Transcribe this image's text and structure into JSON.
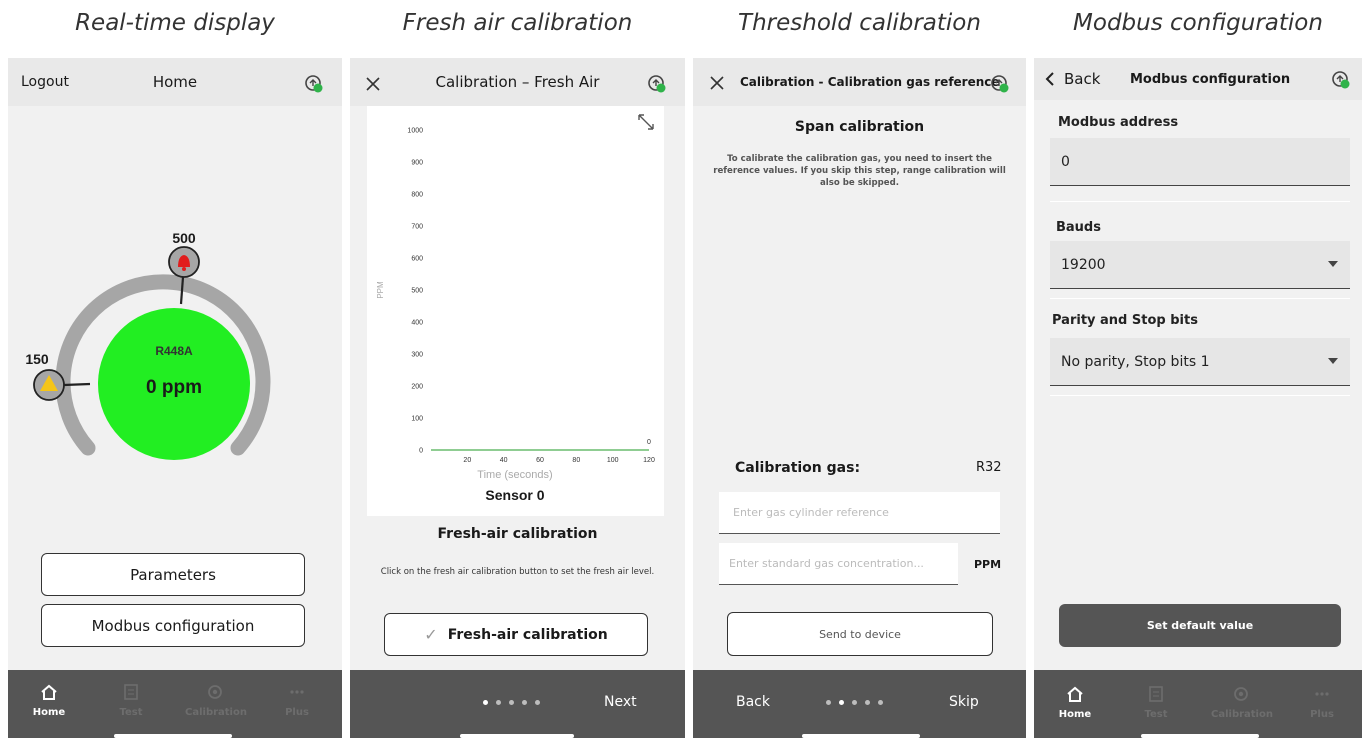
{
  "captions": [
    "Real-time display",
    "Fresh air calibration",
    "Threshold calibration",
    "Modbus configuration"
  ],
  "icons": {
    "status": "sync-status-icon",
    "close": "close-icon",
    "expand": "expand-icon",
    "alarm": "bell-alarm-icon",
    "warning": "warning-icon",
    "check": "check-icon",
    "back": "chevron-left-icon"
  },
  "colors": {
    "gauge_fill": "#22ee22",
    "gauge_ring": "#a6a6a6",
    "alarm_icon": "#e11d1d",
    "warning_icon": "#f5c518",
    "status_green": "#2fb34a",
    "bar_dark": "#555555"
  },
  "nav_labels": [
    "Home",
    "Test",
    "Calibration",
    "Plus"
  ],
  "nav_icons": [
    "home-icon",
    "test-icon",
    "calibration-icon",
    "more-icon"
  ],
  "screen1": {
    "logout": "Logout",
    "title": "Home",
    "gas_name": "R448A",
    "reading": "0 ppm",
    "alarm_threshold": "500",
    "warning_threshold": "150",
    "buttons": [
      "Parameters",
      "Modbus configuration"
    ]
  },
  "screen2": {
    "title": "Calibration – Fresh Air",
    "chart_heading": "Sensor 0",
    "section_title": "Fresh-air calibration",
    "instruction": "Click on the fresh air calibration button to set the fresh air level.",
    "button": "Fresh-air calibration",
    "next": "Next",
    "step": 1,
    "steps": 5
  },
  "chart_data": {
    "type": "line",
    "title": "Sensor 0",
    "xlabel": "Time (seconds)",
    "ylabel": "PPM",
    "xlim": [
      0,
      120
    ],
    "ylim": [
      0,
      1000
    ],
    "x_ticks": [
      20,
      40,
      60,
      80,
      100,
      120
    ],
    "y_ticks": [
      0,
      100,
      200,
      300,
      400,
      500,
      600,
      700,
      800,
      900,
      1000
    ],
    "series": [
      {
        "x": [
          0,
          20,
          40,
          60,
          80,
          100,
          120
        ],
        "y": [
          0,
          0,
          0,
          0,
          0,
          0,
          0
        ]
      }
    ],
    "annotations": [
      {
        "x": 120,
        "y": 0,
        "text": "0"
      }
    ],
    "grid": false
  },
  "screen3": {
    "title": "Calibration - Calibration gas reference",
    "heading": "Span calibration",
    "description": "To calibrate the calibration gas, you need to insert the reference values. If you skip this step, range calibration will also be skipped.",
    "gas_label": "Calibration gas:",
    "gas_value": "R32",
    "placeholder_reference": "Enter gas cylinder reference",
    "placeholder_concentration": "Enter standard gas concentration...",
    "unit": "PPM",
    "send": "Send to device",
    "back": "Back",
    "skip": "Skip",
    "step": 2,
    "steps": 5
  },
  "screen4": {
    "back": "Back",
    "title": "Modbus configuration",
    "address_label": "Modbus address",
    "address_value": "0",
    "bauds_label": "Bauds",
    "bauds_value": "19200",
    "parity_label": "Parity and Stop bits",
    "parity_value": "No parity, Stop bits 1",
    "default_button": "Set default value"
  }
}
